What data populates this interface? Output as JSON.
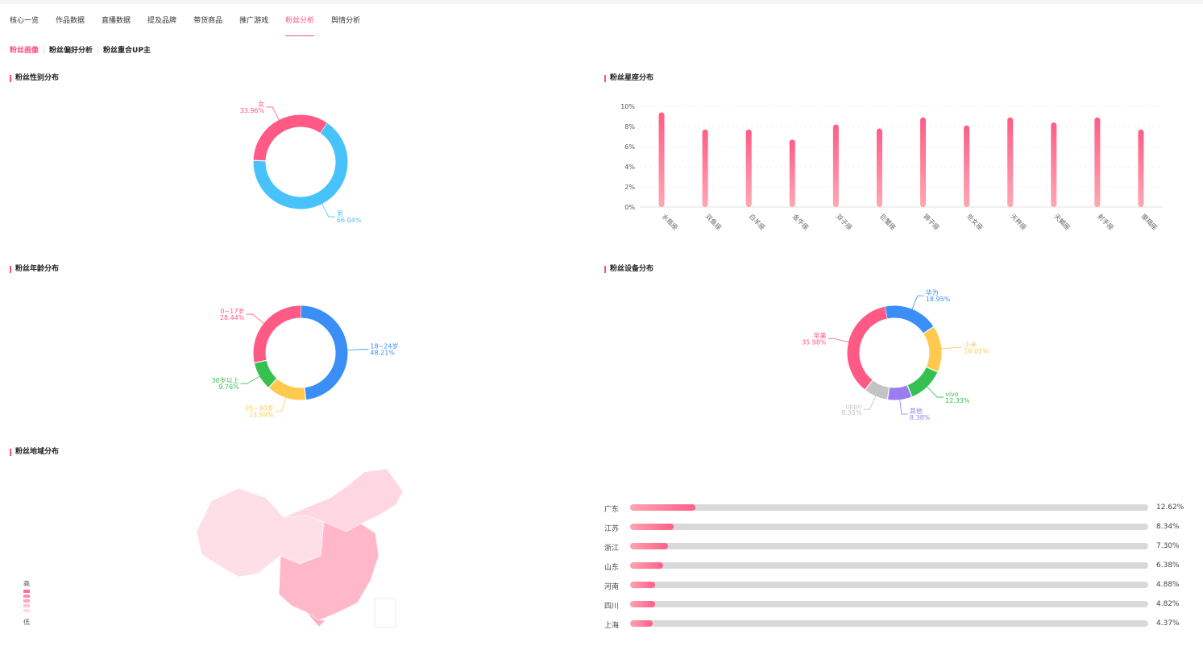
{
  "nav": {
    "tabs": [
      "核心一览",
      "作品数据",
      "直播数据",
      "提及品牌",
      "带货商品",
      "推广游戏",
      "粉丝分析",
      "舆情分析"
    ],
    "active_index": 6
  },
  "subnav": {
    "tabs": [
      "粉丝画像",
      "粉丝偏好分析",
      "粉丝重合UP主"
    ],
    "active_index": 0
  },
  "colors": {
    "accent": "#fe4f7f"
  },
  "sections": {
    "gender": "粉丝性别分布",
    "constellation": "粉丝星座分布",
    "age": "粉丝年龄分布",
    "device": "粉丝设备分布",
    "region": "粉丝地域分布"
  },
  "map_legend": {
    "high": "高",
    "low": "低"
  },
  "chart_data": [
    {
      "type": "pie",
      "donut": true,
      "id": "gender",
      "slices": [
        {
          "label": "男",
          "value": 66.04,
          "display": "66.04%",
          "color": "#48c2fb"
        },
        {
          "label": "女",
          "value": 33.96,
          "display": "33.96%",
          "color": "#ff5a85"
        }
      ]
    },
    {
      "type": "bar",
      "id": "constellation",
      "categories": [
        "水瓶座",
        "双鱼座",
        "白羊座",
        "金牛座",
        "双子座",
        "巨蟹座",
        "狮子座",
        "处女座",
        "天秤座",
        "天蝎座",
        "射手座",
        "摩羯座"
      ],
      "values": [
        9.4,
        7.7,
        7.7,
        6.7,
        8.2,
        7.8,
        8.9,
        8.1,
        8.9,
        8.4,
        8.9,
        7.7
      ],
      "ylim": [
        0,
        10
      ],
      "yticks": [
        "0%",
        "2%",
        "4%",
        "6%",
        "8%",
        "10%"
      ],
      "grid": true
    },
    {
      "type": "pie",
      "donut": true,
      "id": "age",
      "slices": [
        {
          "label": "18~24岁",
          "value": 48.21,
          "display": "48.21%",
          "color": "#3b8ef5"
        },
        {
          "label": "25~30岁",
          "value": 13.59,
          "display": "13.59%",
          "color": "#ffc94d"
        },
        {
          "label": "30岁以上",
          "value": 9.76,
          "display": "9.76%",
          "color": "#35c04f"
        },
        {
          "label": "0~17岁",
          "value": 28.44,
          "display": "28.44%",
          "color": "#ff5a85"
        }
      ]
    },
    {
      "type": "pie",
      "donut": true,
      "id": "device",
      "slices": [
        {
          "label": "华为",
          "value": 18.95,
          "display": "18.95%",
          "color": "#3b8ef5"
        },
        {
          "label": "小米",
          "value": 16.01,
          "display": "16.01%",
          "color": "#ffc94d"
        },
        {
          "label": "vivo",
          "value": 12.33,
          "display": "12.33%",
          "color": "#35c04f"
        },
        {
          "label": "其他",
          "value": 8.38,
          "display": "8.38%",
          "color": "#9b7cf2"
        },
        {
          "label": "oppo",
          "value": 8.35,
          "display": "8.35%",
          "color": "#c4c4c4"
        },
        {
          "label": "苹果",
          "value": 35.98,
          "display": "35.98%",
          "color": "#ff5a85"
        }
      ]
    },
    {
      "type": "bar",
      "id": "region",
      "orientation": "horizontal",
      "categories": [
        "广东",
        "江苏",
        "浙江",
        "山东",
        "河南",
        "四川",
        "上海"
      ],
      "values": [
        12.62,
        8.34,
        7.3,
        6.38,
        4.88,
        4.82,
        4.37
      ],
      "display": [
        "12.62%",
        "8.34%",
        "7.30%",
        "6.38%",
        "4.88%",
        "4.82%",
        "4.37%"
      ],
      "xlim": [
        0,
        100
      ]
    }
  ]
}
